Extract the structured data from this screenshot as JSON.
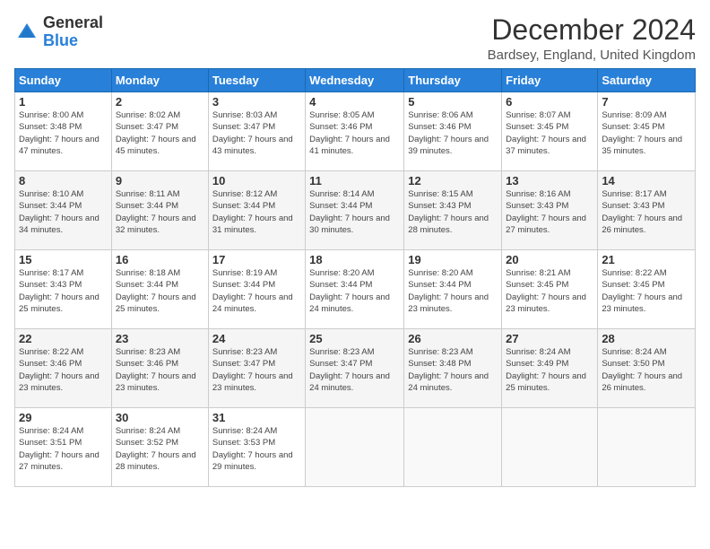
{
  "logo": {
    "general": "General",
    "blue": "Blue"
  },
  "header": {
    "title": "December 2024",
    "location": "Bardsey, England, United Kingdom"
  },
  "weekdays": [
    "Sunday",
    "Monday",
    "Tuesday",
    "Wednesday",
    "Thursday",
    "Friday",
    "Saturday"
  ],
  "weeks": [
    [
      {
        "day": "1",
        "sunrise": "8:00 AM",
        "sunset": "3:48 PM",
        "daylight": "7 hours and 47 minutes."
      },
      {
        "day": "2",
        "sunrise": "8:02 AM",
        "sunset": "3:47 PM",
        "daylight": "7 hours and 45 minutes."
      },
      {
        "day": "3",
        "sunrise": "8:03 AM",
        "sunset": "3:47 PM",
        "daylight": "7 hours and 43 minutes."
      },
      {
        "day": "4",
        "sunrise": "8:05 AM",
        "sunset": "3:46 PM",
        "daylight": "7 hours and 41 minutes."
      },
      {
        "day": "5",
        "sunrise": "8:06 AM",
        "sunset": "3:46 PM",
        "daylight": "7 hours and 39 minutes."
      },
      {
        "day": "6",
        "sunrise": "8:07 AM",
        "sunset": "3:45 PM",
        "daylight": "7 hours and 37 minutes."
      },
      {
        "day": "7",
        "sunrise": "8:09 AM",
        "sunset": "3:45 PM",
        "daylight": "7 hours and 35 minutes."
      }
    ],
    [
      {
        "day": "8",
        "sunrise": "8:10 AM",
        "sunset": "3:44 PM",
        "daylight": "7 hours and 34 minutes."
      },
      {
        "day": "9",
        "sunrise": "8:11 AM",
        "sunset": "3:44 PM",
        "daylight": "7 hours and 32 minutes."
      },
      {
        "day": "10",
        "sunrise": "8:12 AM",
        "sunset": "3:44 PM",
        "daylight": "7 hours and 31 minutes."
      },
      {
        "day": "11",
        "sunrise": "8:14 AM",
        "sunset": "3:44 PM",
        "daylight": "7 hours and 30 minutes."
      },
      {
        "day": "12",
        "sunrise": "8:15 AM",
        "sunset": "3:43 PM",
        "daylight": "7 hours and 28 minutes."
      },
      {
        "day": "13",
        "sunrise": "8:16 AM",
        "sunset": "3:43 PM",
        "daylight": "7 hours and 27 minutes."
      },
      {
        "day": "14",
        "sunrise": "8:17 AM",
        "sunset": "3:43 PM",
        "daylight": "7 hours and 26 minutes."
      }
    ],
    [
      {
        "day": "15",
        "sunrise": "8:17 AM",
        "sunset": "3:43 PM",
        "daylight": "7 hours and 25 minutes."
      },
      {
        "day": "16",
        "sunrise": "8:18 AM",
        "sunset": "3:44 PM",
        "daylight": "7 hours and 25 minutes."
      },
      {
        "day": "17",
        "sunrise": "8:19 AM",
        "sunset": "3:44 PM",
        "daylight": "7 hours and 24 minutes."
      },
      {
        "day": "18",
        "sunrise": "8:20 AM",
        "sunset": "3:44 PM",
        "daylight": "7 hours and 24 minutes."
      },
      {
        "day": "19",
        "sunrise": "8:20 AM",
        "sunset": "3:44 PM",
        "daylight": "7 hours and 23 minutes."
      },
      {
        "day": "20",
        "sunrise": "8:21 AM",
        "sunset": "3:45 PM",
        "daylight": "7 hours and 23 minutes."
      },
      {
        "day": "21",
        "sunrise": "8:22 AM",
        "sunset": "3:45 PM",
        "daylight": "7 hours and 23 minutes."
      }
    ],
    [
      {
        "day": "22",
        "sunrise": "8:22 AM",
        "sunset": "3:46 PM",
        "daylight": "7 hours and 23 minutes."
      },
      {
        "day": "23",
        "sunrise": "8:23 AM",
        "sunset": "3:46 PM",
        "daylight": "7 hours and 23 minutes."
      },
      {
        "day": "24",
        "sunrise": "8:23 AM",
        "sunset": "3:47 PM",
        "daylight": "7 hours and 23 minutes."
      },
      {
        "day": "25",
        "sunrise": "8:23 AM",
        "sunset": "3:47 PM",
        "daylight": "7 hours and 24 minutes."
      },
      {
        "day": "26",
        "sunrise": "8:23 AM",
        "sunset": "3:48 PM",
        "daylight": "7 hours and 24 minutes."
      },
      {
        "day": "27",
        "sunrise": "8:24 AM",
        "sunset": "3:49 PM",
        "daylight": "7 hours and 25 minutes."
      },
      {
        "day": "28",
        "sunrise": "8:24 AM",
        "sunset": "3:50 PM",
        "daylight": "7 hours and 26 minutes."
      }
    ],
    [
      {
        "day": "29",
        "sunrise": "8:24 AM",
        "sunset": "3:51 PM",
        "daylight": "7 hours and 27 minutes."
      },
      {
        "day": "30",
        "sunrise": "8:24 AM",
        "sunset": "3:52 PM",
        "daylight": "7 hours and 28 minutes."
      },
      {
        "day": "31",
        "sunrise": "8:24 AM",
        "sunset": "3:53 PM",
        "daylight": "7 hours and 29 minutes."
      },
      null,
      null,
      null,
      null
    ]
  ]
}
